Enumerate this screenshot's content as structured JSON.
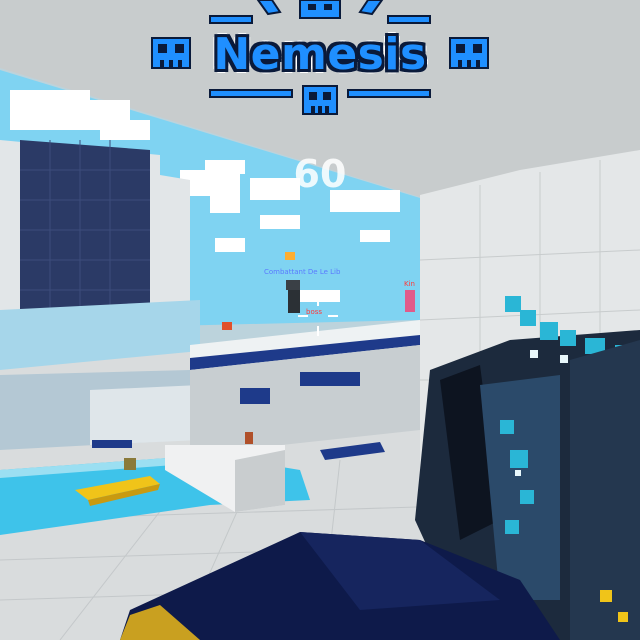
{
  "banner": {
    "title": "Nemesis",
    "icon": "skull-icon"
  },
  "hud": {
    "counter": "60",
    "crosshair_icon": "crosshair-icon"
  },
  "players": {
    "name_1": "Combattant De Le Lib",
    "name_2": "Kin",
    "name_3": "boss"
  },
  "colors": {
    "banner_text": "#1f8fff",
    "banner_outline": "#0a1a3a",
    "water": "#3ec3ea",
    "sky": "#7fd3f2",
    "weapon_accent": "#2ab6d6"
  }
}
